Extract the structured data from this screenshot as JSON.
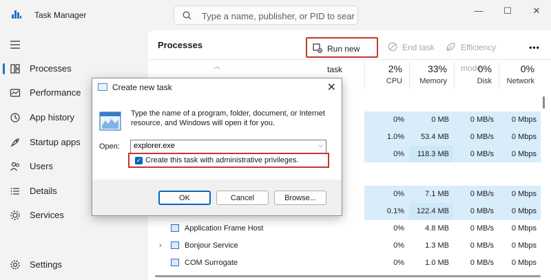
{
  "window": {
    "title": "Task Manager",
    "search_placeholder": "Type a name, publisher, or PID to sear...",
    "controls": {
      "minimize": "—",
      "maximize": "☐",
      "close": "✕"
    }
  },
  "sidebar": {
    "items": [
      {
        "label": "Processes",
        "icon": "processes-icon",
        "active": true
      },
      {
        "label": "Performance",
        "icon": "performance-icon"
      },
      {
        "label": "App history",
        "icon": "app-history-icon"
      },
      {
        "label": "Startup apps",
        "icon": "startup-apps-icon"
      },
      {
        "label": "Users",
        "icon": "users-icon"
      },
      {
        "label": "Details",
        "icon": "details-icon"
      },
      {
        "label": "Services",
        "icon": "services-icon"
      }
    ],
    "settings_label": "Settings"
  },
  "toolbar": {
    "page_title": "Processes",
    "run_new_task": "Run new task",
    "end_task": "End task",
    "efficiency_mode": "Efficiency mode",
    "more": "•••"
  },
  "columns": [
    {
      "pct": "2%",
      "name": "CPU"
    },
    {
      "pct": "33%",
      "name": "Memory"
    },
    {
      "pct": "0%",
      "name": "Disk"
    },
    {
      "pct": "0%",
      "name": "Network"
    }
  ],
  "rows": [
    {
      "name": "",
      "cpu": "0%",
      "memory": "0 MB",
      "disk": "0 MB/s",
      "network": "0 Mbps"
    },
    {
      "name": "",
      "cpu": "1.0%",
      "memory": "53.4 MB",
      "disk": "0 MB/s",
      "network": "0 Mbps"
    },
    {
      "name": "",
      "cpu": "0%",
      "memory": "118.3 MB",
      "disk": "0 MB/s",
      "network": "0 Mbps"
    },
    {
      "name": "",
      "cpu": "0%",
      "memory": "7.1 MB",
      "disk": "0 MB/s",
      "network": "0 Mbps"
    },
    {
      "name": "",
      "cpu": "0.1%",
      "memory": "122.4 MB",
      "disk": "0 MB/s",
      "network": "0 Mbps"
    },
    {
      "name": "Application Frame Host",
      "cpu": "0%",
      "memory": "4.8 MB",
      "disk": "0 MB/s",
      "network": "0 Mbps"
    },
    {
      "name": "Bonjour Service",
      "cpu": "0%",
      "memory": "1.3 MB",
      "disk": "0 MB/s",
      "network": "0 Mbps"
    },
    {
      "name": "COM Surrogate",
      "cpu": "0%",
      "memory": "1.0 MB",
      "disk": "0 MB/s",
      "network": "0 Mbps"
    }
  ],
  "dialog": {
    "title": "Create new task",
    "description": "Type the name of a program, folder, document, or Internet resource, and Windows will open it for you.",
    "open_label": "Open:",
    "open_value": "explorer.exe",
    "admin_checkbox_label": "Create this task with administrative privileges.",
    "admin_checked": true,
    "ok": "OK",
    "cancel": "Cancel",
    "browse": "Browse...",
    "close": "✕"
  },
  "colors": {
    "accent": "#0067c0",
    "highlight_border": "#c0392b",
    "heat_low": "#fff4c4",
    "heat_mid": "#ffe89a",
    "heat_high": "#ffd96a"
  }
}
